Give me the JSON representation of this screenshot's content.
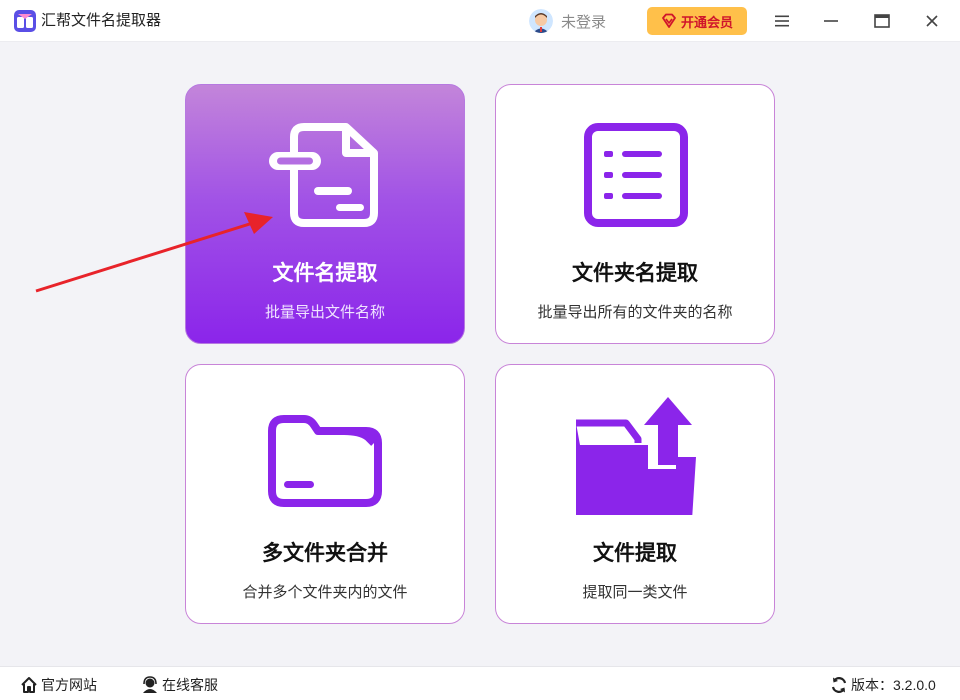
{
  "app": {
    "title": "汇帮文件名提取器"
  },
  "header": {
    "user_label": "未登录",
    "vip_label": "开通会员"
  },
  "cards": [
    {
      "title": "文件名提取",
      "subtitle": "批量导出文件名称",
      "icon": "document-icon",
      "active": true
    },
    {
      "title": "文件夹名提取",
      "subtitle": "批量导出所有的文件夹的名称",
      "icon": "list-icon",
      "active": false
    },
    {
      "title": "多文件夹合并",
      "subtitle": "合并多个文件夹内的文件",
      "icon": "folder-icon",
      "active": false
    },
    {
      "title": "文件提取",
      "subtitle": "提取同一类文件",
      "icon": "folder-export-icon",
      "active": false
    }
  ],
  "footer": {
    "website_label": "官方网站",
    "support_label": "在线客服",
    "version_label": "版本：3.2.0.0"
  },
  "colors": {
    "accent_purple": "#8b25ea",
    "card_border": "#c884d8",
    "vip_bg": "#ffc04a",
    "vip_text": "#d0152b",
    "arrow": "#e8232a"
  }
}
